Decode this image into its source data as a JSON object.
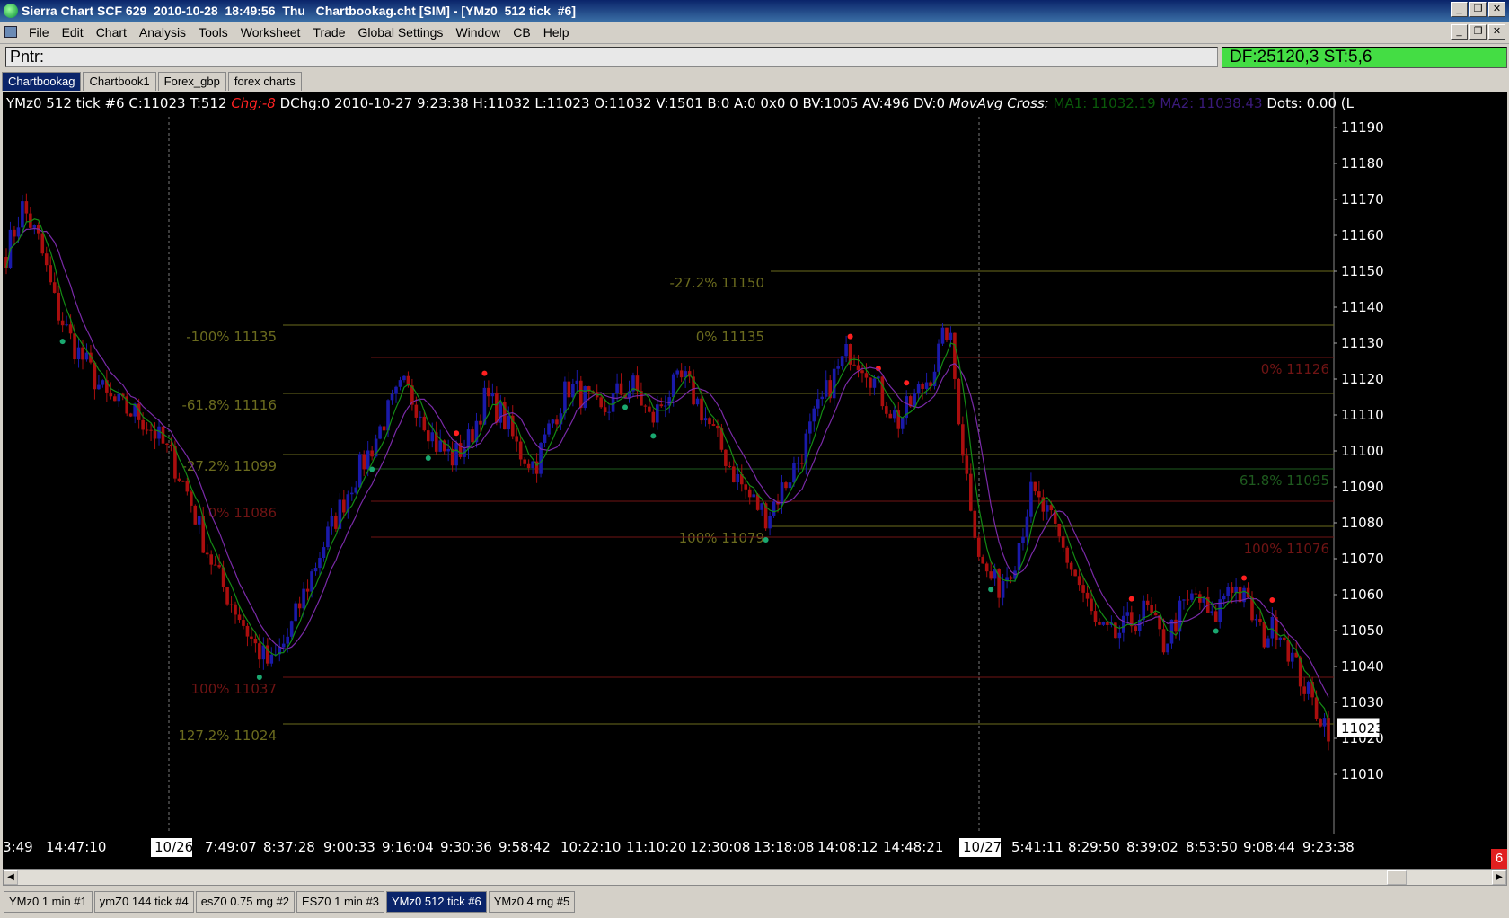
{
  "window": {
    "title": "Sierra Chart SCF 629  2010-10-28  18:49:56  Thu   Chartbookag.cht [SIM] - [YMz0  512 tick  #6]"
  },
  "menu": [
    "File",
    "Edit",
    "Chart",
    "Analysis",
    "Tools",
    "Worksheet",
    "Trade",
    "Global Settings",
    "Window",
    "CB",
    "Help"
  ],
  "pointer": {
    "label": "Pntr:",
    "df": "DF:25120,3   ST:5,6"
  },
  "chartbook_tabs": [
    "Chartbookag",
    "Chartbook1",
    "Forex_gbp",
    "forex charts"
  ],
  "header": {
    "prefix": "YMz0  512 tick  #6 C:11023 T:512 ",
    "chg": "Chg:-8",
    "middle": " DChg:0 2010-10-27 9:23:38 H:11032 L:11023 O:11032 V:1501 B:0 A:0 0x0 0 BV:1005 AV:496 DV:0 ",
    "study": "MovAvg Cross:",
    "ma1": " MA1: 11032.19 ",
    "ma2": " MA2: 11038.43 ",
    "dots": " Dots: 0.00 ",
    "tail": "(L"
  },
  "colors": {
    "up": "#1a1aaa",
    "down": "#aa0e0e",
    "ma1": "#148c14",
    "ma2": "#7a2aa8",
    "fib_olive": "#6b6b1e",
    "fib_red": "#701414",
    "fib_green": "#1e5a1e"
  },
  "chart_data": {
    "type": "candlestick",
    "y_axis": {
      "min": 11005,
      "max": 11195,
      "ticks": [
        11190,
        11180,
        11170,
        11160,
        11150,
        11140,
        11130,
        11120,
        11110,
        11100,
        11090,
        11080,
        11070,
        11060,
        11050,
        11040,
        11030,
        11020,
        11010
      ]
    },
    "last_price": "11023",
    "x_labels": [
      "3:49",
      "14:47:10",
      "10/26",
      "7:49:07",
      "8:37:28",
      "9:00:33",
      "9:16:04",
      "9:30:36",
      "9:58:42",
      "10:22:10",
      "11:10:20",
      "12:30:08",
      "13:18:08",
      "14:08:12",
      "14:48:21",
      "10/27",
      "5:41:11",
      "8:29:50",
      "8:39:02",
      "8:53:50",
      "9:08:44",
      "9:23:38"
    ],
    "fib_lines": [
      {
        "label": "-100% 11135",
        "value": 11135,
        "color": "olive"
      },
      {
        "label": "-61.8% 11116",
        "value": 11116,
        "color": "olive"
      },
      {
        "label": "-27.2% 11099",
        "value": 11099,
        "color": "olive"
      },
      {
        "label": "0% 11086",
        "value": 11086,
        "color": "red"
      },
      {
        "label": "100% 11037",
        "value": 11037,
        "color": "red"
      },
      {
        "label": "127.2% 11024",
        "value": 11024,
        "color": "olive"
      },
      {
        "label": "-27.2% 11150",
        "value": 11150,
        "color": "olive"
      },
      {
        "label": "0% 11135",
        "value": 11135,
        "color": "olive"
      },
      {
        "label": "100% 11079",
        "value": 11079,
        "color": "olive"
      },
      {
        "label": "0% 11126",
        "value": 11126,
        "color": "red"
      },
      {
        "label": "61.8% 11095",
        "value": 11095,
        "color": "green"
      },
      {
        "label": "100% 11076",
        "value": 11076,
        "color": "red"
      }
    ],
    "close_path": [
      11155,
      11168,
      11158,
      11140,
      11130,
      11123,
      11115,
      11112,
      11110,
      11105,
      11098,
      11088,
      11074,
      11063,
      11055,
      11046,
      11040,
      11048,
      11060,
      11072,
      11082,
      11092,
      11100,
      11110,
      11118,
      11112,
      11102,
      11098,
      11103,
      11115,
      11110,
      11100,
      11096,
      11108,
      11118,
      11115,
      11110,
      11116,
      11118,
      11108,
      11116,
      11120,
      11112,
      11103,
      11094,
      11087,
      11082,
      11090,
      11098,
      11110,
      11120,
      11128,
      11124,
      11115,
      11108,
      11115,
      11122,
      11135,
      11096,
      11068,
      11062,
      11070,
      11088,
      11082,
      11072,
      11062,
      11050,
      11048,
      11052,
      11056,
      11046,
      11055,
      11060,
      11052,
      11064,
      11058,
      11048,
      11052,
      11040,
      11030,
      11023
    ]
  },
  "bottom_tabs": [
    "YMz0  1 min  #1",
    "ymZ0  144 tick  #4",
    "esZ0  0.75 rng  #2",
    "ESZ0  1 min  #3",
    "YMz0  512 tick  #6",
    "YMz0  4 rng  #5"
  ],
  "badge": "6"
}
